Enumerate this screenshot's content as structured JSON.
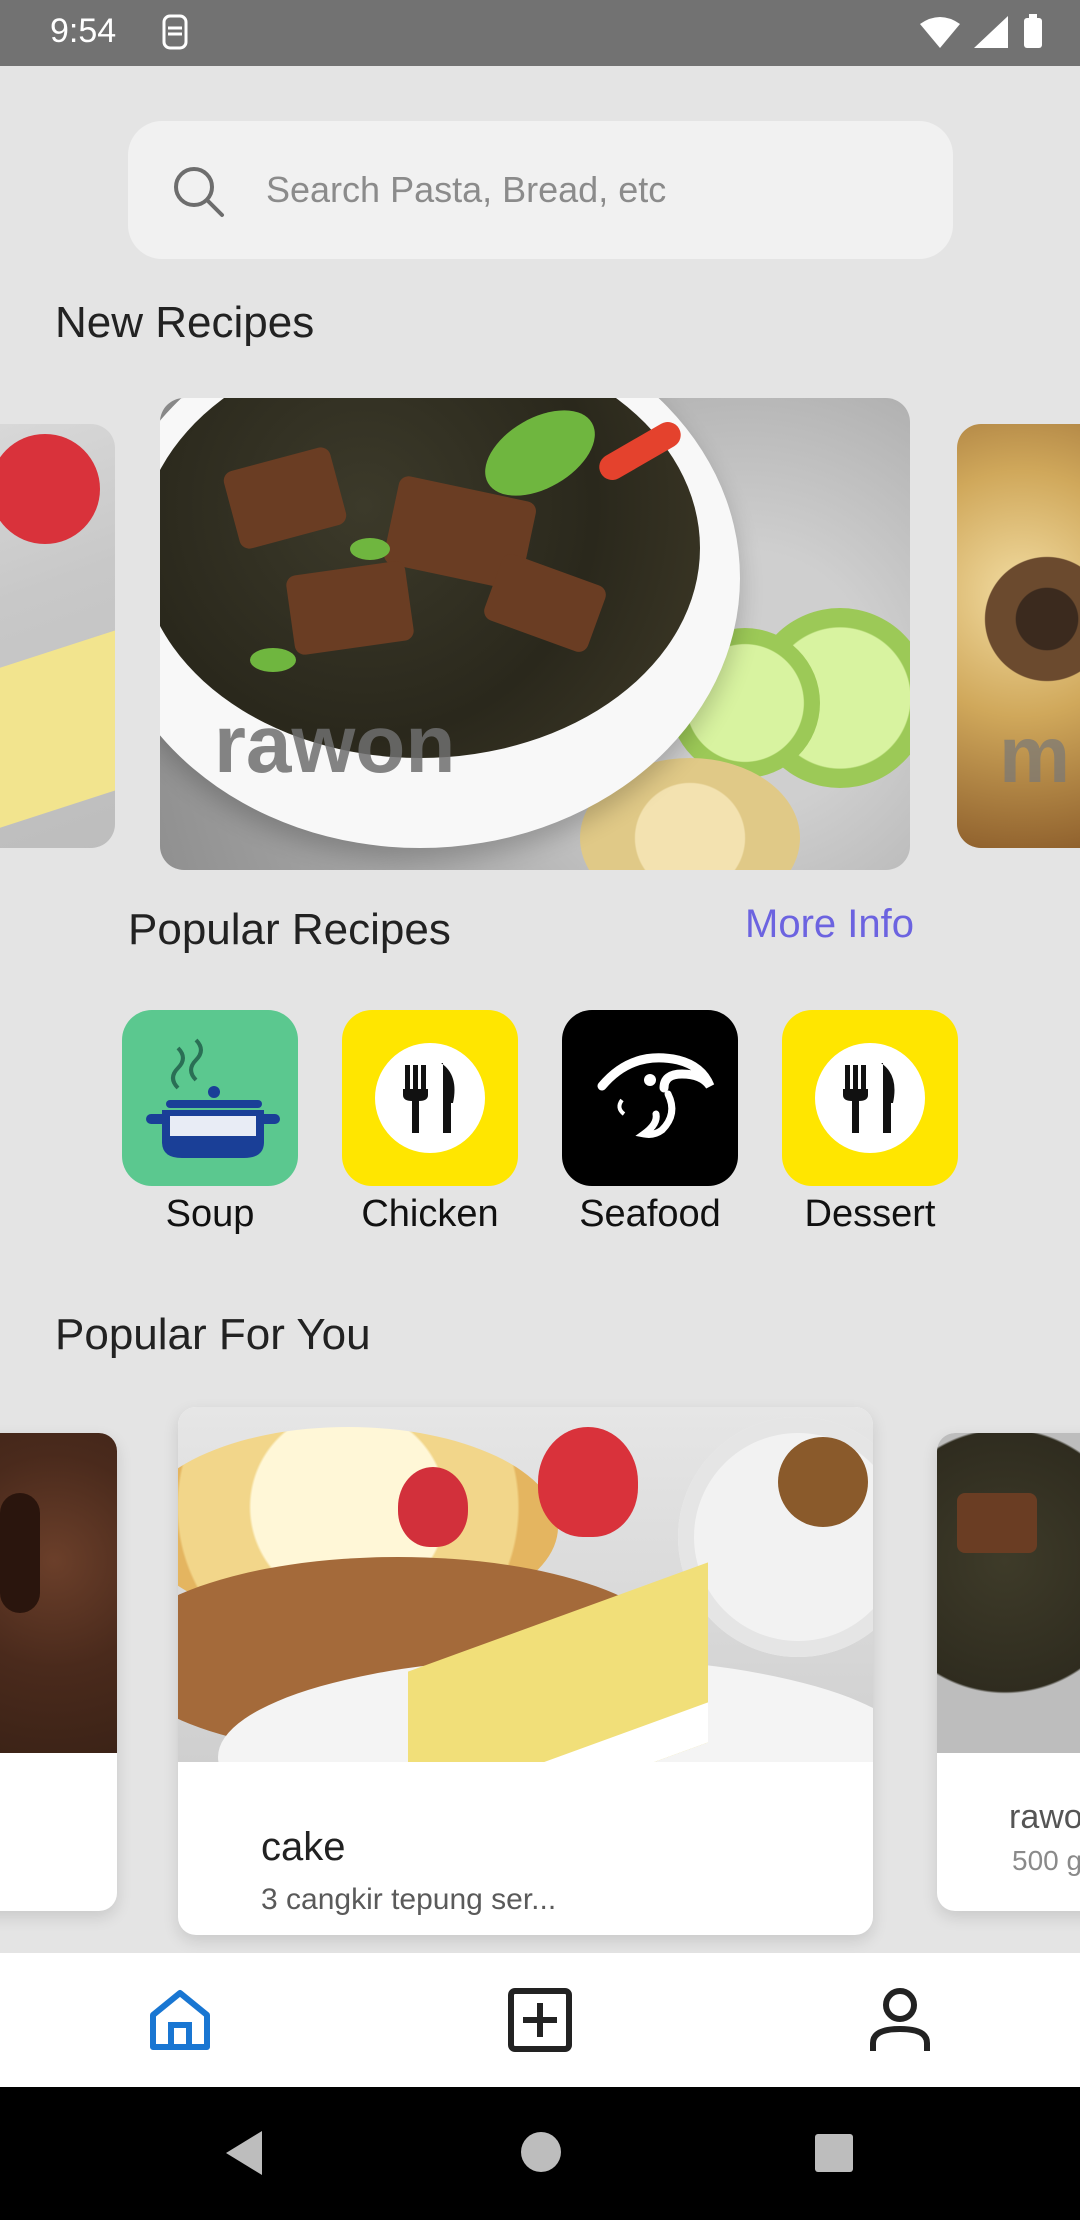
{
  "status_bar": {
    "time": "9:54"
  },
  "search": {
    "placeholder": "Search Pasta, Bread, etc"
  },
  "sections": {
    "new_recipes": "New Recipes",
    "popular_recipes": "Popular Recipes",
    "more_info": "More Info",
    "popular_for_you": "Popular For You"
  },
  "carousel": {
    "center_text": "rawon",
    "right_text": "m"
  },
  "categories": [
    {
      "label": "Soup",
      "color": "#5bc88f"
    },
    {
      "label": "Chicken",
      "color": "#ffe600"
    },
    {
      "label": "Seafood",
      "color": "#000000"
    },
    {
      "label": "Dessert",
      "color": "#ffe600"
    }
  ],
  "popular_for_you": {
    "center": {
      "name": "cake",
      "desc": "3 cangkir tepung ser..."
    },
    "right": {
      "name": "rawo",
      "desc": "500 g"
    }
  },
  "colors": {
    "accent": "#6c63e0",
    "nav_active": "#1976d2"
  }
}
